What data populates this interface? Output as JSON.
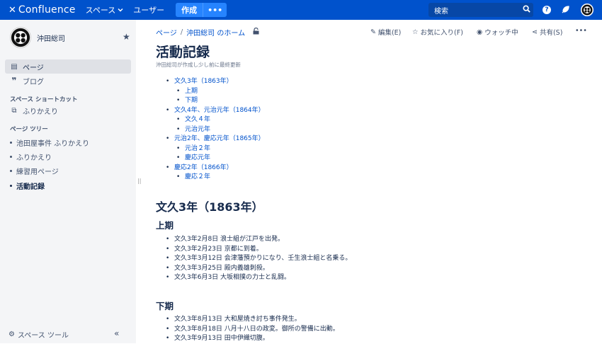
{
  "topbar": {
    "logo": "Confluence",
    "nav_spaces": "スペース",
    "nav_users": "ユーザー",
    "create": "作成",
    "create_more": "•••",
    "search_placeholder": "検索"
  },
  "sidebar": {
    "space_name": "沖田総司",
    "pages": "ページ",
    "blog": "ブログ",
    "shortcuts_heading": "スペース ショートカット",
    "shortcut_1": "ふりかえり",
    "tree_heading": "ページ ツリー",
    "tree": [
      "池田屋事件 ふりかえり",
      "ふりかえり",
      "練習用ページ",
      "活動記録"
    ],
    "tools": "スペース ツール",
    "collapse": "«"
  },
  "breadcrumb": {
    "items": [
      "ページ",
      "沖田総司 のホーム"
    ],
    "separator": "/"
  },
  "actions": {
    "edit": "編集(E)",
    "favorite": "お気に入り(F)",
    "watching": "ウォッチ中",
    "share": "共有(S)",
    "more": "•••"
  },
  "page": {
    "title": "活動記録",
    "byline": "沖田総司が作成し少し前に最終更新",
    "toc": [
      {
        "label": "文久3年（1863年）",
        "level": 1
      },
      {
        "label": "上期",
        "level": 2
      },
      {
        "label": "下期",
        "level": 2
      },
      {
        "label": "文久4年、元治元年（1864年）",
        "level": 1
      },
      {
        "label": "文久４年",
        "level": 2
      },
      {
        "label": "元治元年",
        "level": 2
      },
      {
        "label": "元治2年、慶応元年（1865年）",
        "level": 1
      },
      {
        "label": "元治２年",
        "level": 2
      },
      {
        "label": "慶応元年",
        "level": 2
      },
      {
        "label": "慶応2年（1866年）",
        "level": 1
      },
      {
        "label": "慶応２年",
        "level": 2
      }
    ],
    "section_heading": "文久3年（1863年）",
    "first_half_heading": "上期",
    "first_half": [
      "文久3年2月8日 浪士組が江戸を出発。",
      "文久3年2月23日 京都に到着。",
      "文久3年3月12日 会津藩預かりになり、壬生浪士組と名乗る。",
      "文久3年3月25日 殿内義雄刺殺。",
      "文久3年6月3日 大坂相撲の力士と乱闘。"
    ],
    "second_half_heading": "下期",
    "second_half": [
      "文久3年8月13日 大和屋焼き討ち事件発生。",
      "文久3年8月18日 八月十八日の政変。御所の警備に出動。",
      "文久3年9月13日 田中伊織切腹。"
    ]
  },
  "colors": {
    "topbar": "#0052cc",
    "create_button": "#2684ff",
    "link": "#0052cc",
    "sidebar_bg": "#f4f5f7"
  }
}
